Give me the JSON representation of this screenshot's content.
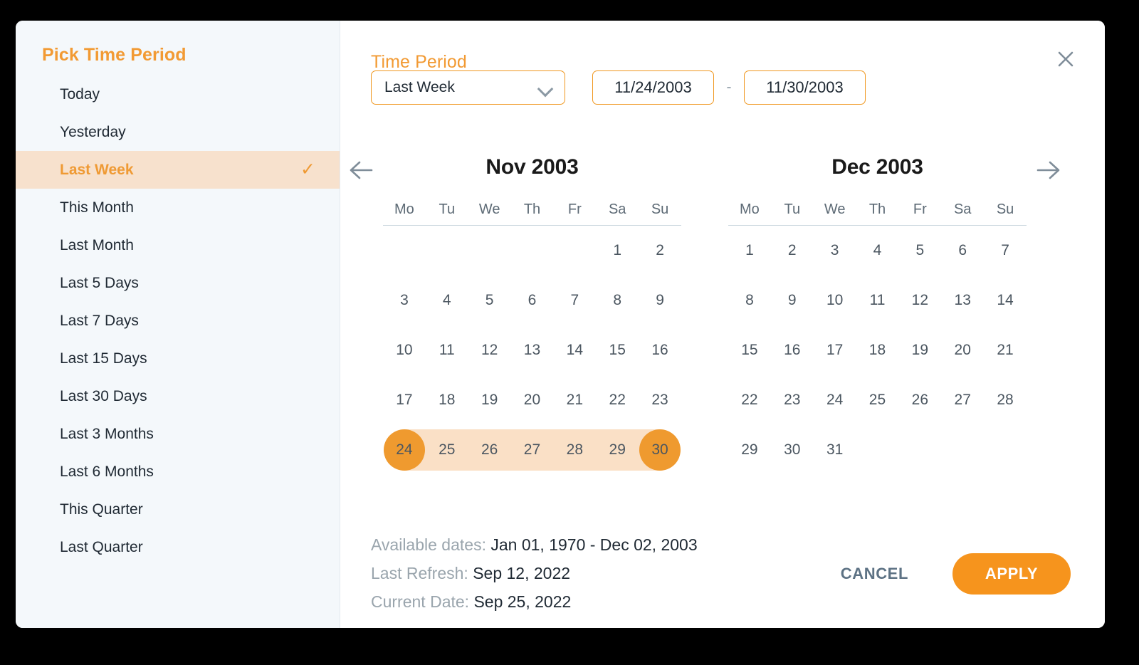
{
  "sidebar": {
    "title": "Pick Time Period",
    "selected_index": 2,
    "check_glyph": "✓",
    "items": [
      {
        "label": "Today"
      },
      {
        "label": "Yesterday"
      },
      {
        "label": "Last Week"
      },
      {
        "label": "This Month"
      },
      {
        "label": "Last Month"
      },
      {
        "label": "Last 5 Days"
      },
      {
        "label": "Last 7 Days"
      },
      {
        "label": "Last 15 Days"
      },
      {
        "label": "Last 30 Days"
      },
      {
        "label": "Last 3 Months"
      },
      {
        "label": "Last 6 Months"
      },
      {
        "label": "This Quarter"
      },
      {
        "label": "Last Quarter"
      }
    ]
  },
  "main": {
    "time_period_label": "Time Period",
    "close_icon": "close-icon",
    "preset_select": {
      "value": "Last Week",
      "icon": "chevron-down-icon"
    },
    "start_date": {
      "value": "11/24/2003",
      "placeholder": "MM/DD/YYYY"
    },
    "range_separator": "-",
    "end_date": {
      "value": "11/30/2003",
      "placeholder": "MM/DD/YYYY"
    },
    "prev_icon": "arrow-left-icon",
    "next_icon": "arrow-right-icon"
  },
  "calendars": [
    {
      "title": "Nov 2003",
      "dow": [
        "Mo",
        "Tu",
        "We",
        "Th",
        "Fr",
        "Sa",
        "Su"
      ],
      "lead_blanks": 5,
      "days": [
        1,
        2,
        3,
        4,
        5,
        6,
        7,
        8,
        9,
        10,
        11,
        12,
        13,
        14,
        15,
        16,
        17,
        18,
        19,
        20,
        21,
        22,
        23,
        24,
        25,
        26,
        27,
        28,
        29,
        30
      ],
      "range_start_day": 24,
      "range_end_day": 30
    },
    {
      "title": "Dec 2003",
      "dow": [
        "Mo",
        "Tu",
        "We",
        "Th",
        "Fr",
        "Sa",
        "Su"
      ],
      "lead_blanks": 0,
      "days": [
        1,
        2,
        3,
        4,
        5,
        6,
        7,
        8,
        9,
        10,
        11,
        12,
        13,
        14,
        15,
        16,
        17,
        18,
        19,
        20,
        21,
        22,
        23,
        24,
        25,
        26,
        27,
        28,
        29,
        30,
        31
      ],
      "range_start_day": null,
      "range_end_day": null
    }
  ],
  "footer": {
    "meta": [
      {
        "label": "Available dates:",
        "value": "Jan 01, 1970 - Dec 02, 2003"
      },
      {
        "label": "Last Refresh:",
        "value": "Sep 12, 2022"
      },
      {
        "label": "Current Date:",
        "value": "Sep 25, 2022"
      }
    ],
    "cancel_label": "CANCEL",
    "apply_label": "APPLY"
  },
  "colors": {
    "accent": "#f6941d",
    "accent_light": "#fae0c6",
    "sidebar_selected_bg": "#f7e1cd",
    "sidebar_bg": "#f4f8fb",
    "text": "#1f2933",
    "muted": "#9aa5ad"
  }
}
